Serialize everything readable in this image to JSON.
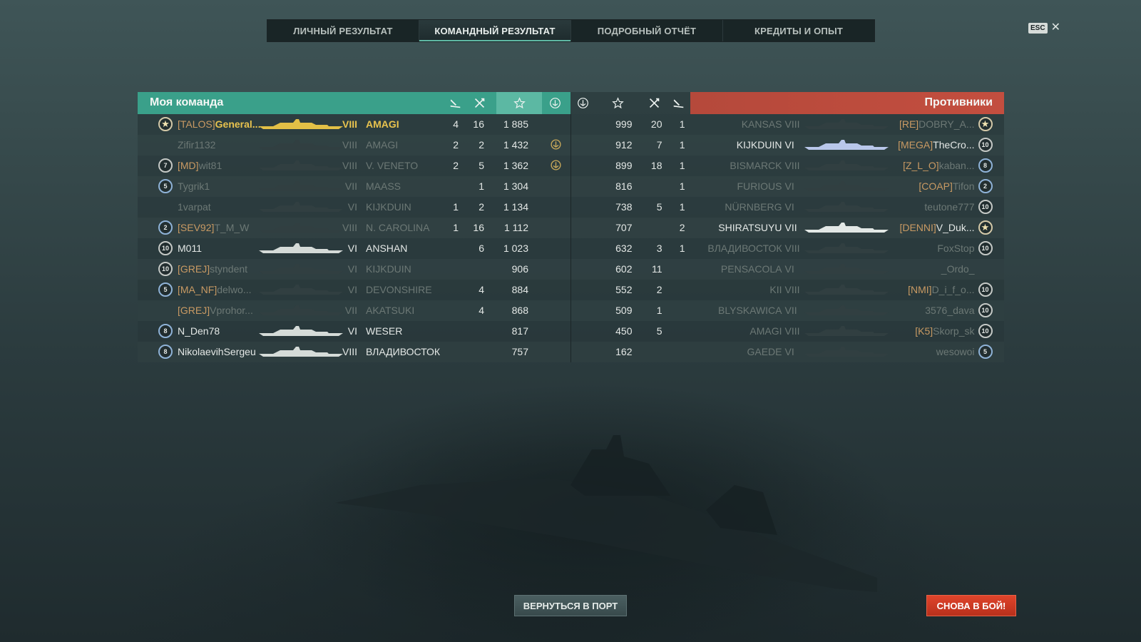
{
  "tabs": [
    {
      "label": "ЛИЧНЫЙ РЕЗУЛЬТАТ",
      "active": false
    },
    {
      "label": "КОМАНДНЫЙ РЕЗУЛЬТАТ",
      "active": true
    },
    {
      "label": "ПОДРОБНЫЙ ОТЧЁТ",
      "active": false
    },
    {
      "label": "КРЕДИТЫ И ОПЫТ",
      "active": false
    }
  ],
  "esc": {
    "key": "ESC",
    "close": "✕"
  },
  "my_team": {
    "title": "Моя команда",
    "columns": [
      "planes-icon",
      "kills-icon",
      "star-icon",
      "anchor-icon"
    ],
    "players": [
      {
        "badge": "★",
        "clan": "[TALOS]",
        "name": "General...",
        "tier": "VIII",
        "ship": "AMAGI",
        "c1": "4",
        "c2": "16",
        "xp": "1 885",
        "anchor": false,
        "alive": true,
        "me": true
      },
      {
        "badge": "",
        "clan": "",
        "name": "Zifir1132",
        "tier": "VIII",
        "ship": "AMAGI",
        "c1": "2",
        "c2": "2",
        "xp": "1 432",
        "anchor": true,
        "alive": false,
        "me": false
      },
      {
        "badge": "7",
        "clan": "[MD]",
        "name": "wit81",
        "tier": "VIII",
        "ship": "V. VENETO",
        "c1": "2",
        "c2": "5",
        "xp": "1 362",
        "anchor": true,
        "alive": false,
        "me": false
      },
      {
        "badge": "5",
        "clan": "",
        "name": "Tygrik1",
        "tier": "VII",
        "ship": "MAASS",
        "c1": "",
        "c2": "1",
        "xp": "1 304",
        "anchor": false,
        "alive": false,
        "me": false
      },
      {
        "badge": "",
        "clan": "",
        "name": "1varpat",
        "tier": "VI",
        "ship": "KIJKDUIN",
        "c1": "1",
        "c2": "2",
        "xp": "1 134",
        "anchor": false,
        "alive": false,
        "me": false
      },
      {
        "badge": "2",
        "clan": "[SEV92]",
        "name": "T_M_W",
        "tier": "VIII",
        "ship": "N. CAROLINA",
        "c1": "1",
        "c2": "16",
        "xp": "1 112",
        "anchor": false,
        "alive": false,
        "me": false
      },
      {
        "badge": "10",
        "clan": "",
        "name": "M011",
        "tier": "VI",
        "ship": "ANSHAN",
        "c1": "",
        "c2": "6",
        "xp": "1 023",
        "anchor": false,
        "alive": true,
        "me": false
      },
      {
        "badge": "10",
        "clan": "[GREJ]",
        "name": "styndent",
        "tier": "VI",
        "ship": "KIJKDUIN",
        "c1": "",
        "c2": "",
        "xp": "906",
        "anchor": false,
        "alive": false,
        "me": false
      },
      {
        "badge": "5",
        "clan": "[MA_NF]",
        "name": "delwo...",
        "tier": "VI",
        "ship": "DEVONSHIRE",
        "c1": "",
        "c2": "4",
        "xp": "884",
        "anchor": false,
        "alive": false,
        "me": false
      },
      {
        "badge": "",
        "clan": "[GREJ]",
        "name": "Vprohor...",
        "tier": "VII",
        "ship": "AKATSUKI",
        "c1": "",
        "c2": "4",
        "xp": "868",
        "anchor": false,
        "alive": false,
        "me": false
      },
      {
        "badge": "8",
        "clan": "",
        "name": "N_Den78",
        "tier": "VI",
        "ship": "WESER",
        "c1": "",
        "c2": "",
        "xp": "817",
        "anchor": false,
        "alive": true,
        "me": false
      },
      {
        "badge": "8",
        "clan": "",
        "name": "NikolaevihSergeu",
        "tier": "VIII",
        "ship": "ВЛАДИВОСТОК",
        "c1": "",
        "c2": "",
        "xp": "757",
        "anchor": false,
        "alive": true,
        "me": false
      }
    ]
  },
  "enemy_team": {
    "title": "Противники",
    "columns": [
      "anchor-icon",
      "star-icon",
      "kills-icon",
      "planes-icon"
    ],
    "players": [
      {
        "xp": "999",
        "c2": "20",
        "c1": "1",
        "ship": "KANSAS",
        "tier": "VIII",
        "clan": "[RE]",
        "name": "DOBRY_A...",
        "badge": "★",
        "alive": false
      },
      {
        "xp": "912",
        "c2": "7",
        "c1": "1",
        "ship": "KIJKDUIN",
        "tier": "VI",
        "clan": "[MEGA]",
        "name": "TheCro...",
        "badge": "10",
        "alive": true
      },
      {
        "xp": "899",
        "c2": "18",
        "c1": "1",
        "ship": "BISMARCK",
        "tier": "VIII",
        "clan": "[Z_L_O]",
        "name": "kaban...",
        "badge": "8",
        "alive": false
      },
      {
        "xp": "816",
        "c2": "",
        "c1": "1",
        "ship": "FURIOUS",
        "tier": "VI",
        "clan": "[COAP]",
        "name": "Tifon",
        "badge": "2",
        "alive": false
      },
      {
        "xp": "738",
        "c2": "5",
        "c1": "1",
        "ship": "NÜRNBERG",
        "tier": "VI",
        "clan": "",
        "name": "teutone777",
        "badge": "10",
        "alive": false
      },
      {
        "xp": "707",
        "c2": "",
        "c1": "2",
        "ship": "SHIRATSUYU",
        "tier": "VII",
        "clan": "[DENNI]",
        "name": "V_Duk...",
        "badge": "★",
        "alive": true
      },
      {
        "xp": "632",
        "c2": "3",
        "c1": "1",
        "ship": "ВЛАДИВОСТОК",
        "tier": "VIII",
        "clan": "",
        "name": "FoxStop",
        "badge": "10",
        "alive": false
      },
      {
        "xp": "602",
        "c2": "11",
        "c1": "",
        "ship": "PENSACOLA",
        "tier": "VI",
        "clan": "",
        "name": "_Ordo_",
        "badge": "",
        "alive": false
      },
      {
        "xp": "552",
        "c2": "2",
        "c1": "",
        "ship": "KII",
        "tier": "VIII",
        "clan": "[NMI]",
        "name": "D_i_f_o...",
        "badge": "10",
        "alive": false
      },
      {
        "xp": "509",
        "c2": "1",
        "c1": "",
        "ship": "BLYSKAWICA",
        "tier": "VII",
        "clan": "",
        "name": "3576_dava",
        "badge": "10",
        "alive": false
      },
      {
        "xp": "450",
        "c2": "5",
        "c1": "",
        "ship": "AMAGI",
        "tier": "VIII",
        "clan": "[K5]",
        "name": "Skorp_sk",
        "badge": "10",
        "alive": false
      },
      {
        "xp": "162",
        "c2": "",
        "c1": "",
        "ship": "GAEDE",
        "tier": "VI",
        "clan": "",
        "name": "wesowoi",
        "badge": "5",
        "alive": false
      }
    ]
  },
  "buttons": {
    "port": "ВЕРНУТЬСЯ В ПОРТ",
    "battle": "СНОВА В БОЙ!"
  },
  "colors": {
    "my_team": "#3aa08a",
    "enemy_team": "#c34e3f",
    "highlight": "#e8c34e",
    "clan": "#c99a63",
    "battle_button": "#d03a22"
  }
}
